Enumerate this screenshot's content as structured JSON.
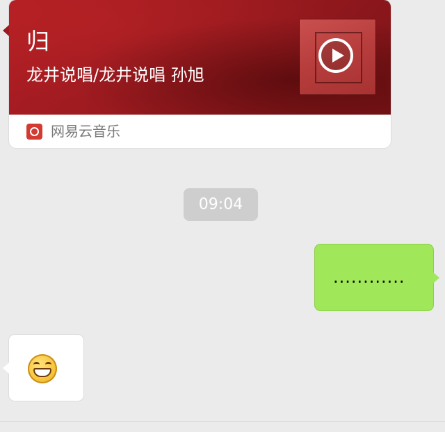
{
  "music_card": {
    "title": "归",
    "subtitle": "龙井说唱/龙井说唱 孙旭",
    "source_label": "网易云音乐",
    "accent_color": "#9c1b20",
    "play_icon": "play-icon",
    "source_icon": "netease-music-icon"
  },
  "timestamp": "09:04",
  "sent_message": {
    "text": "............",
    "bubble_color": "#a0e759"
  },
  "received_message": {
    "emoji": "grin-emoji-icon"
  }
}
